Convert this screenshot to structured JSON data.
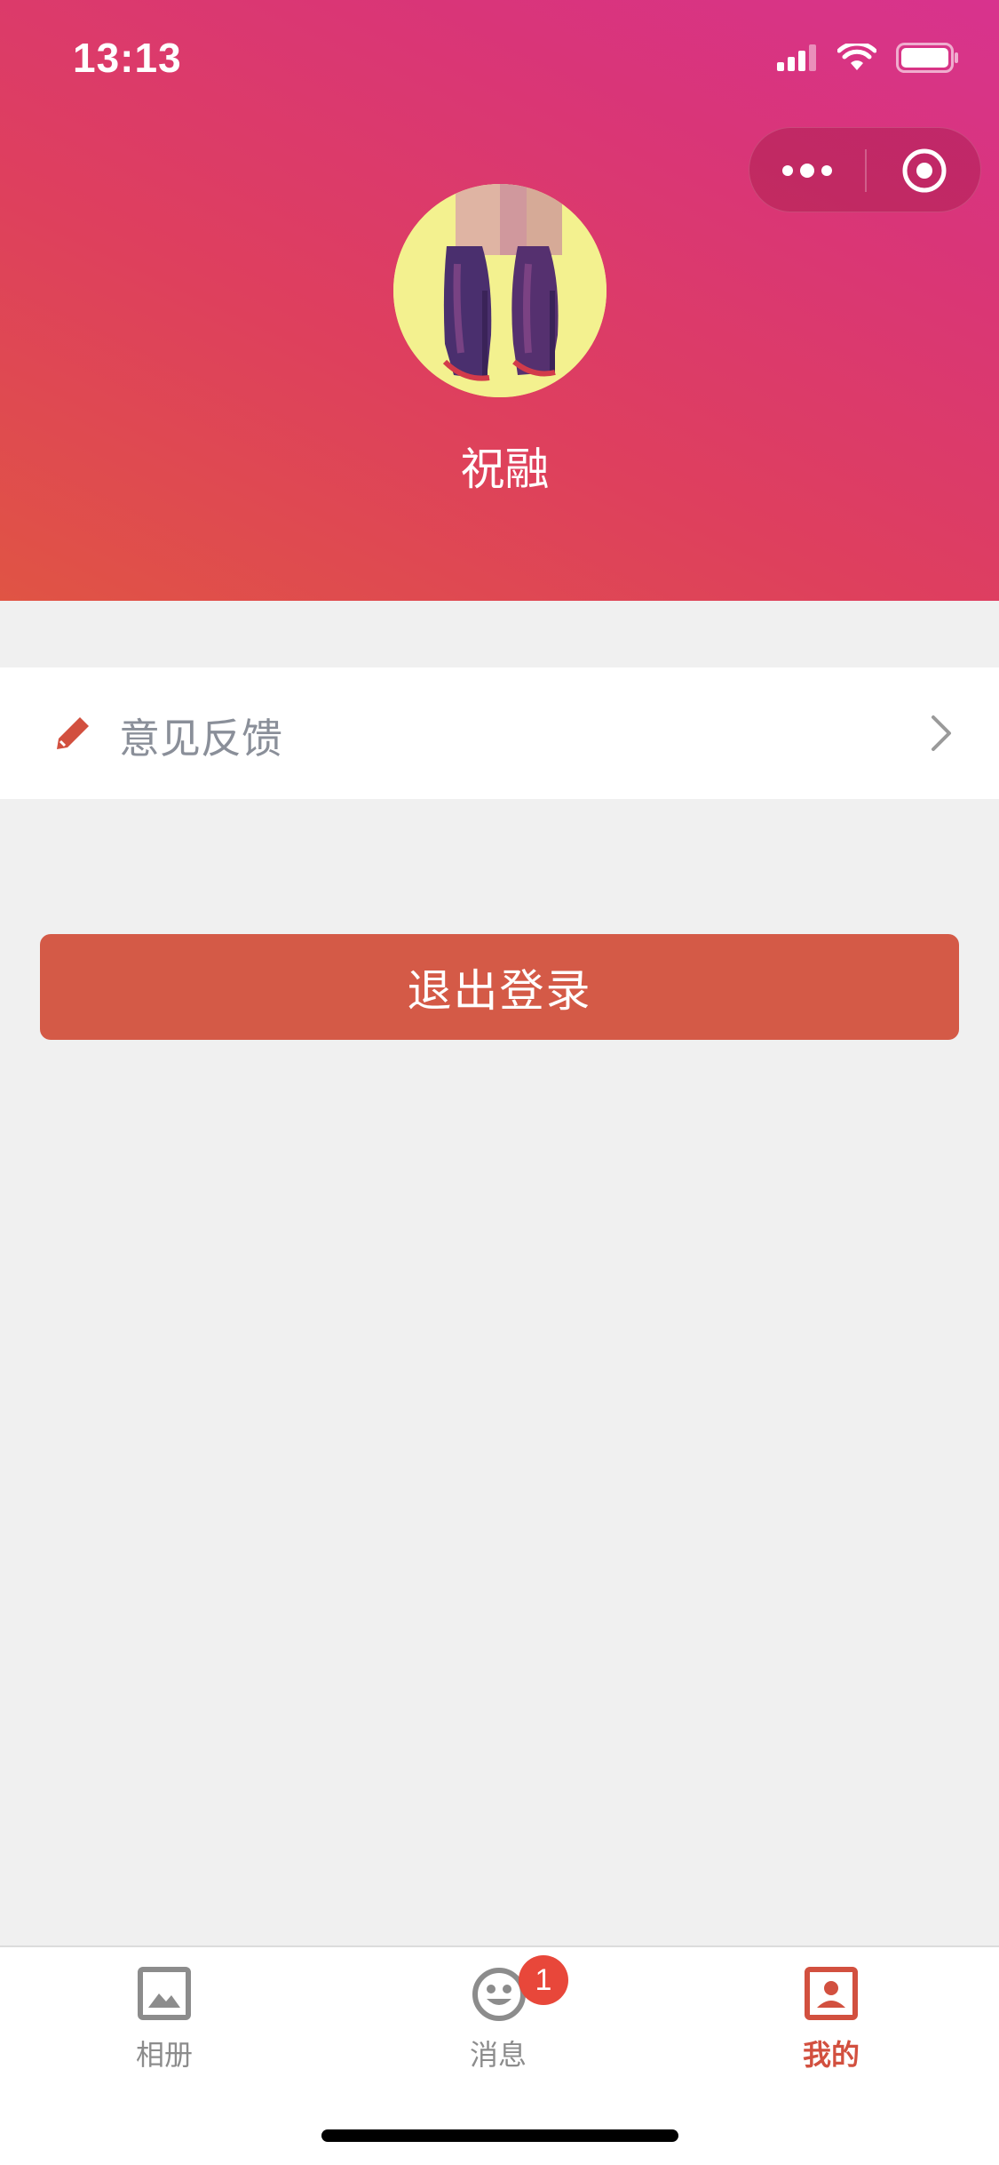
{
  "status_bar": {
    "time": "13:13"
  },
  "profile": {
    "username": "祝融"
  },
  "menu": {
    "feedback_label": "意见反馈"
  },
  "actions": {
    "logout_label": "退出登录"
  },
  "tabbar": {
    "tabs": [
      {
        "label": "相册",
        "icon": "album-icon"
      },
      {
        "label": "消息",
        "icon": "smiley-icon"
      },
      {
        "label": "我的",
        "icon": "profile-icon"
      }
    ],
    "active_tab": "我的",
    "message_badge": "1"
  },
  "colors": {
    "gradient_start": "#e05444",
    "gradient_end": "#d8338e",
    "accent": "#d45a47",
    "active_tab": "#d2503f",
    "badge": "#e8473a"
  }
}
